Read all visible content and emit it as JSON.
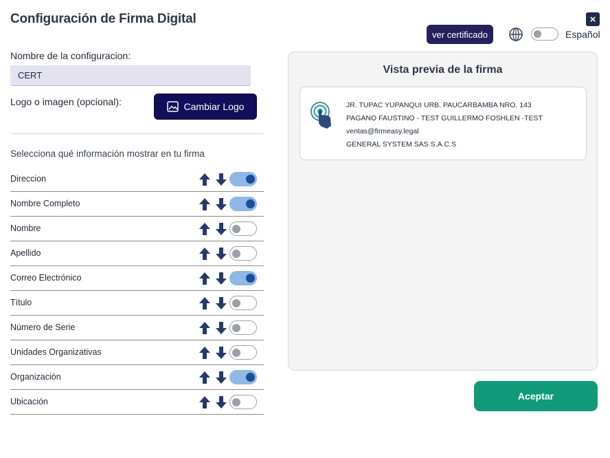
{
  "header": {
    "title": "Configuración de Firma Digital",
    "close_label": "×",
    "cert_button": "ver certificado",
    "language": "Español"
  },
  "form": {
    "name_label": "Nombre de la configuracion:",
    "name_value": "CERT",
    "logo_label": "Logo o imagen (opcional):",
    "logo_button": "Cambiar Logo",
    "fields_heading": "Selecciona qué información mostrar en tu firma"
  },
  "fields": [
    {
      "label": "Direccion",
      "enabled": true
    },
    {
      "label": "Nombre Completo",
      "enabled": true
    },
    {
      "label": "Nombre",
      "enabled": false
    },
    {
      "label": "Apellido",
      "enabled": false
    },
    {
      "label": "Correo Electrónico",
      "enabled": true
    },
    {
      "label": "Título",
      "enabled": false
    },
    {
      "label": "Número de Serie",
      "enabled": false
    },
    {
      "label": "Unidades Organizativas",
      "enabled": false
    },
    {
      "label": "Organización",
      "enabled": true
    },
    {
      "label": "Ubicación",
      "enabled": false
    }
  ],
  "preview": {
    "title": "Vista previa de la firma",
    "lines": [
      "JR. TUPAC YUPANQUI URB. PAUCARBAMBA NRO. 143",
      "PAGANO FAUSTINO - TEST GUILLERMO FOSHLEN -TEST",
      "ventas@firmeasy.legal",
      "GENERAL SYSTEM SAS S.A.C.S"
    ]
  },
  "footer": {
    "accept_button": "Aceptar"
  },
  "icons": {
    "close": "close-icon",
    "globe": "globe-icon",
    "image": "image-icon",
    "arrow_up": "arrow-up-icon",
    "arrow_down": "arrow-down-icon",
    "signature_logo": "touch-fingerprint-icon"
  },
  "colors": {
    "primary_dark": "#120e5a",
    "cert_button": "#26215c",
    "accept": "#109a79",
    "toggle_on": "#8db8e8",
    "toggle_knob_on": "#1b4f93",
    "arrow": "#263a6a"
  }
}
